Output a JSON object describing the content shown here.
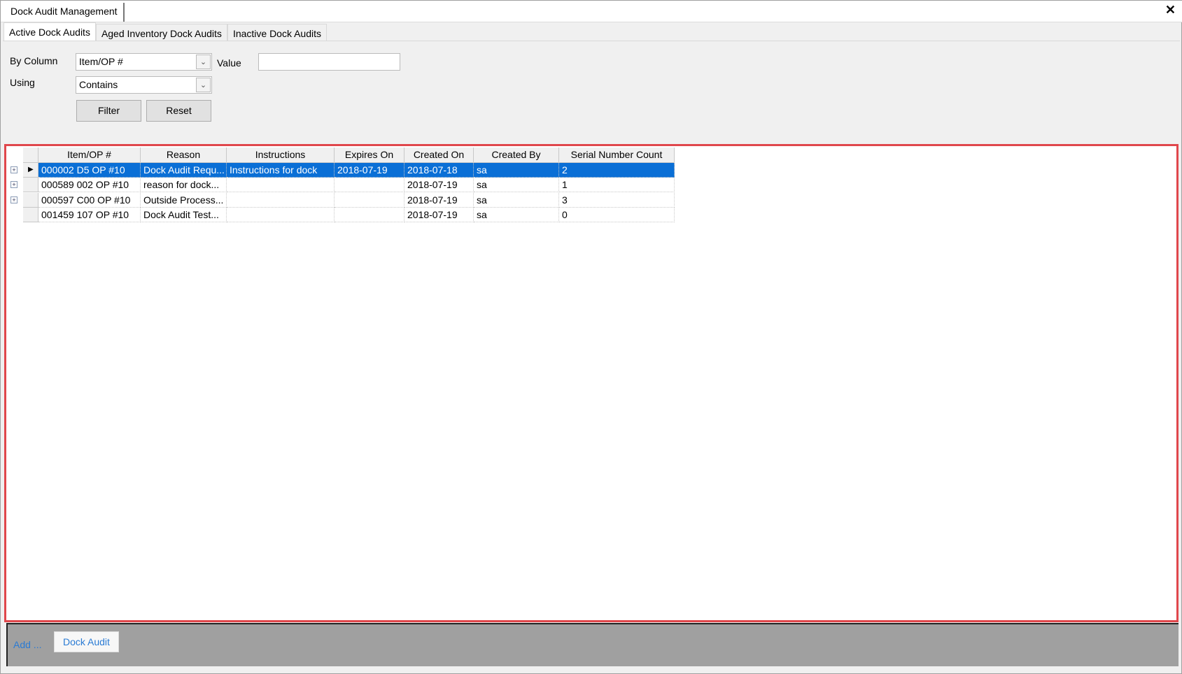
{
  "window": {
    "title": "Dock Audit Management",
    "close_icon": "close-icon"
  },
  "tabs": [
    {
      "label": "Active Dock Audits",
      "active": true
    },
    {
      "label": "Aged Inventory Dock Audits",
      "active": false
    },
    {
      "label": "Inactive Dock Audits",
      "active": false
    }
  ],
  "filter": {
    "by_column_label": "By Column",
    "by_column_value": "Item/OP #",
    "value_label": "Value",
    "value_input": "",
    "using_label": "Using",
    "using_value": "Contains",
    "filter_button": "Filter",
    "reset_button": "Reset"
  },
  "grid": {
    "columns": [
      "Item/OP #",
      "Reason",
      "Instructions",
      "Expires On",
      "Created On",
      "Created By",
      "Serial Number Count"
    ],
    "rows": [
      [
        "000002 D5 OP #10",
        "Dock Audit Requ...",
        "Instructions for dock",
        "2018-07-19",
        "2018-07-18",
        "sa",
        "2"
      ],
      [
        "000589 002 OP #10",
        "reason for dock...",
        "",
        "",
        "2018-07-19",
        "sa",
        "1"
      ],
      [
        "000597 C00 OP #10",
        "Outside Process...",
        "",
        "",
        "2018-07-19",
        "sa",
        "3"
      ],
      [
        "001459 107 OP #10",
        "Dock Audit Test...",
        "",
        "",
        "2018-07-19",
        "sa",
        "0"
      ]
    ],
    "expandable": [
      true,
      true,
      true,
      false
    ],
    "selected_row": 0,
    "highlight_color": "#e0474c",
    "selection_color": "#0a6fd6"
  },
  "footer": {
    "add_label": "Add ...",
    "dock_audit_button": "Dock Audit"
  }
}
